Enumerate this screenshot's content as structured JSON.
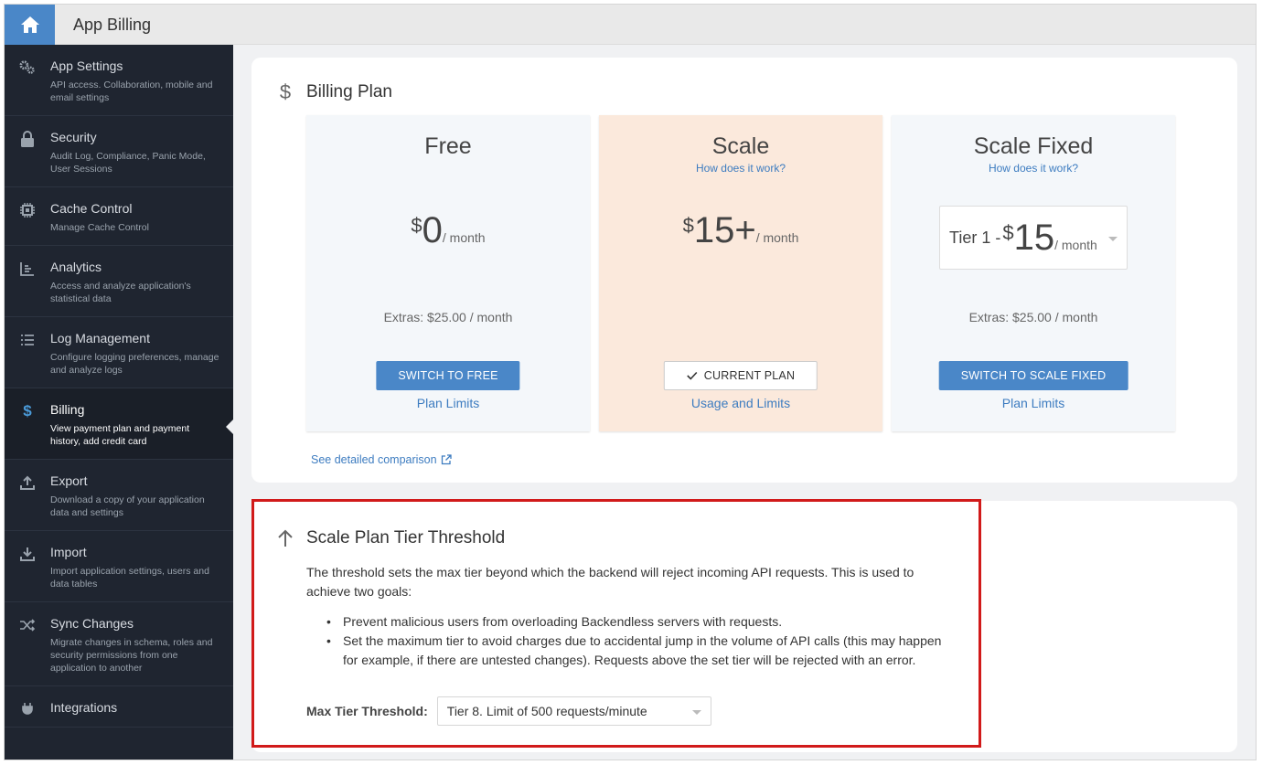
{
  "header": {
    "title": "App Billing"
  },
  "sidebar": {
    "items": [
      {
        "title": "App Settings",
        "desc": "API access. Collaboration, mobile and email settings",
        "icon": "gears-icon"
      },
      {
        "title": "Security",
        "desc": "Audit Log, Compliance, Panic Mode, User Sessions",
        "icon": "lock-icon"
      },
      {
        "title": "Cache Control",
        "desc": "Manage Cache Control",
        "icon": "chip-icon"
      },
      {
        "title": "Analytics",
        "desc": "Access and analyze application's statistical data",
        "icon": "chart-icon"
      },
      {
        "title": "Log Management",
        "desc": "Configure logging preferences, manage and analyze logs",
        "icon": "list-icon"
      },
      {
        "title": "Billing",
        "desc": "View payment plan and payment history, add credit card",
        "icon": "dollar-icon",
        "active": true
      },
      {
        "title": "Export",
        "desc": "Download a copy of your application data and settings",
        "icon": "upload-icon"
      },
      {
        "title": "Import",
        "desc": "Import application settings, users and data tables",
        "icon": "download-icon"
      },
      {
        "title": "Sync Changes",
        "desc": "Migrate changes in schema, roles and security permissions from one application to another",
        "icon": "shuffle-icon"
      },
      {
        "title": "Integrations",
        "desc": "",
        "icon": "plug-icon"
      }
    ]
  },
  "billing_plan": {
    "title": "Billing Plan",
    "currency_symbol": "$",
    "compare_link": "See detailed comparison",
    "plans": [
      {
        "name": "Free",
        "how": "",
        "price": "0",
        "per": "/ month",
        "extras": "Extras: $25.00 / month",
        "button": "SWITCH TO FREE",
        "link": "Plan Limits"
      },
      {
        "name": "Scale",
        "how": "How does it work?",
        "price": "15+",
        "per": "/ month",
        "extras": "",
        "button": "CURRENT PLAN",
        "link": "Usage and Limits",
        "current": true
      },
      {
        "name": "Scale Fixed",
        "how": "How does it work?",
        "tier_label": "Tier 1 -",
        "price": "15",
        "per": "/ month",
        "extras": "Extras: $25.00 / month",
        "button": "SWITCH TO SCALE FIXED",
        "link": "Plan Limits"
      }
    ]
  },
  "threshold": {
    "title": "Scale Plan Tier Threshold",
    "paragraph": "The threshold sets the max tier beyond which the backend will reject incoming API requests. This is used to achieve two goals:",
    "bullets": [
      "Prevent malicious users from overloading Backendless servers with requests.",
      "Set the maximum tier to avoid charges due to accidental jump in the volume of API calls (this may happen for example, if there are untested changes). Requests above the set tier will be rejected with an error."
    ],
    "field_label": "Max Tier Threshold:",
    "selected": "Tier 8. Limit of 500 requests/minute"
  },
  "colors": {
    "accent": "#4a87c8",
    "sidebar_bg": "#1f2530",
    "current_plan_bg": "#fbe9dc",
    "highlight_border": "#d11a1a"
  }
}
